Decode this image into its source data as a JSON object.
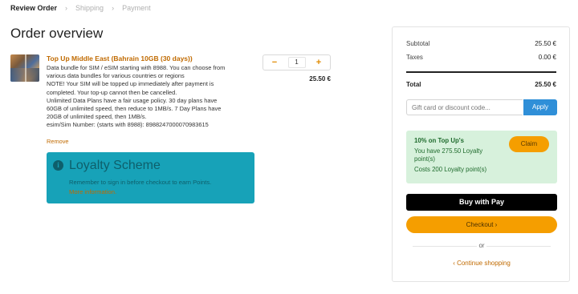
{
  "breadcrumb": {
    "steps": [
      "Review Order",
      "Shipping",
      "Payment"
    ],
    "separator": "›"
  },
  "page_title": "Order overview",
  "product": {
    "title": "Top Up Middle East (Bahrain 10GB (30 days))",
    "description_lines": [
      "Data bundle for SIM / eSIM starting with 8988. You can choose from",
      "various data bundles for various countries or regions",
      "NOTE! Your SIM will be topped up immediately after payment is",
      "completed. Your top-up cannot then be cancelled.",
      "Unlimited Data Plans have a fair usage policy. 30 day plans have",
      "60GB of unlimited speed, then reduce to 1MB/s. 7 Day Plans have",
      "20GB of unlimited speed, then 1MB/s.",
      "esim/Sim Number: (starts with 8988): 8988247000070983615"
    ],
    "remove_label": "Remove",
    "quantity": "1",
    "minus_label": "−",
    "plus_label": "+",
    "price": "25.50 €"
  },
  "loyalty": {
    "icon": "info-icon",
    "title": "Loyalty Scheme",
    "message": "Remember to sign in before checkout to earn Points.",
    "more_link": "More information."
  },
  "summary": {
    "subtotal_label": "Subtotal",
    "subtotal_value": "25.50 €",
    "taxes_label": "Taxes",
    "taxes_value": "0.00 €",
    "total_label": "Total",
    "total_value": "25.50 €",
    "discount_placeholder": "Gift card or discount code...",
    "apply_label": "Apply",
    "promo": {
      "heading": "10% on Top Up's",
      "lines": [
        "You have 275.50 Loyalty",
        "point(s)",
        "Costs 200 Loyalty point(s)"
      ],
      "claim_label": "Claim"
    },
    "applepay_label": "Buy with  Pay",
    "checkout_label": "Checkout  ›",
    "or_label": "or",
    "continue_label": "‹   Continue shopping"
  },
  "colors": {
    "accent": "#f59e00",
    "link": "#c06a00",
    "loyalty_bg": "#17a2b8",
    "apply_bg": "#2f8fd8",
    "promo_bg": "#d7f1dc"
  }
}
